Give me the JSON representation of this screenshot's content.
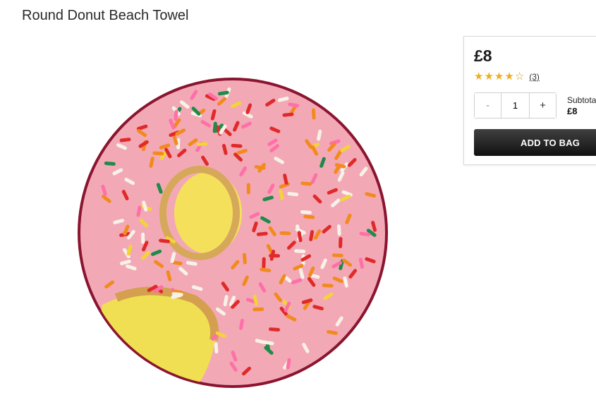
{
  "product": {
    "title": "Round Donut Beach Towel",
    "price": "£8",
    "rating": 3.5,
    "review_count": "(3)"
  },
  "purchase": {
    "minus_label": "-",
    "plus_label": "+",
    "quantity": "1",
    "subtotal_label": "Subtotal",
    "subtotal_value": "£8",
    "add_to_bag_label": "ADD TO BAG"
  },
  "icons": {
    "star_full": "star-icon",
    "star_half": "star-half-icon",
    "star_empty": "star-empty-icon"
  },
  "colors": {
    "star": "#f0ad1e",
    "button_top": "#404040",
    "button_bottom": "#111111",
    "frosting": "#f4a6b4"
  }
}
